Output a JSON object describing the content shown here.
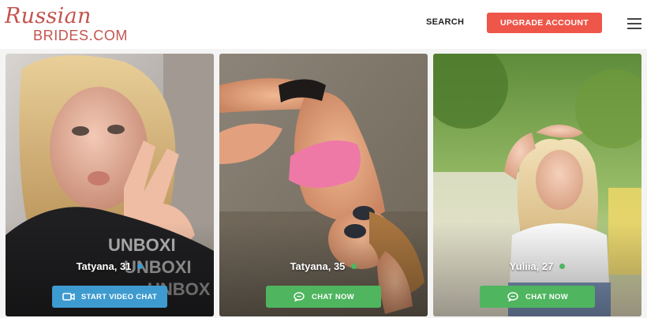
{
  "header": {
    "logo_top": "Russian",
    "logo_bottom": "BRIDES.COM",
    "search_label": "SEARCH",
    "upgrade_label": "UPGRADE ACCOUNT",
    "menu_icon": "hamburger-menu-icon"
  },
  "colors": {
    "brand": "#c4544e",
    "upgrade": "#ee5649",
    "video_button": "#3e9bd0",
    "chat_button": "#4fb55f",
    "online_blue": "#3e9bd0",
    "online_green": "#4fb55f"
  },
  "cards": [
    {
      "name": "Tatyana, 31",
      "online_color": "#3e9bd0",
      "button_label": "START VIDEO CHAT",
      "button_icon": "video-camera-icon"
    },
    {
      "name": "Tatyana, 35",
      "online_color": "#4fb55f",
      "button_label": "CHAT NOW",
      "button_icon": "chat-bubble-icon"
    },
    {
      "name": "Yuliia, 27",
      "online_color": "#4fb55f",
      "button_label": "CHAT NOW",
      "button_icon": "chat-bubble-icon"
    }
  ]
}
